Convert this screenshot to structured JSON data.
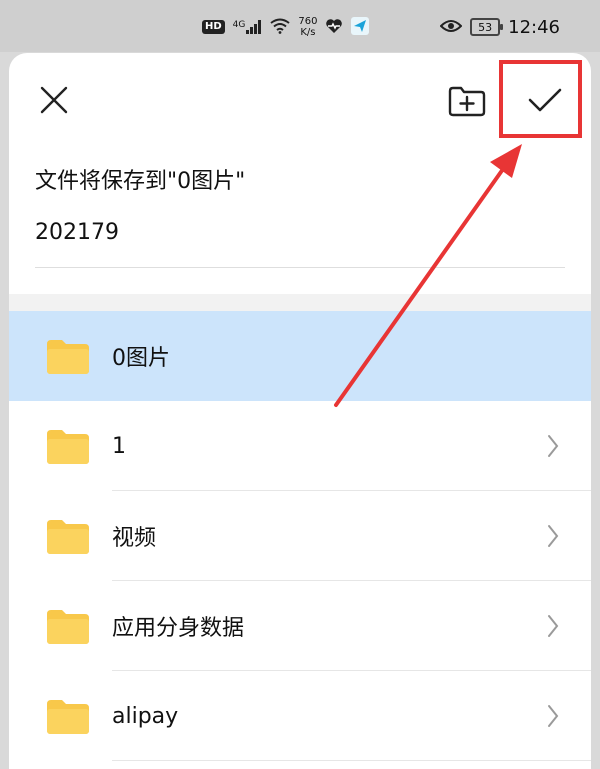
{
  "status_bar": {
    "hd": "HD",
    "network": "4G",
    "speed_value": "760",
    "speed_unit": "K/s",
    "battery": "53",
    "time": "12:46"
  },
  "dialog": {
    "save_to_text": "文件将保存到\"0图片\"",
    "filename_value": "202179"
  },
  "folders": [
    {
      "name": "0图片",
      "selected": true,
      "has_chevron": false
    },
    {
      "name": "1",
      "selected": false,
      "has_chevron": true
    },
    {
      "name": "视频",
      "selected": false,
      "has_chevron": true
    },
    {
      "name": "应用分身数据",
      "selected": false,
      "has_chevron": true
    },
    {
      "name": "alipay",
      "selected": false,
      "has_chevron": true
    }
  ],
  "colors": {
    "folder": "#f8c84a",
    "selected_row": "#cce4fb",
    "highlight": "#e83535"
  }
}
